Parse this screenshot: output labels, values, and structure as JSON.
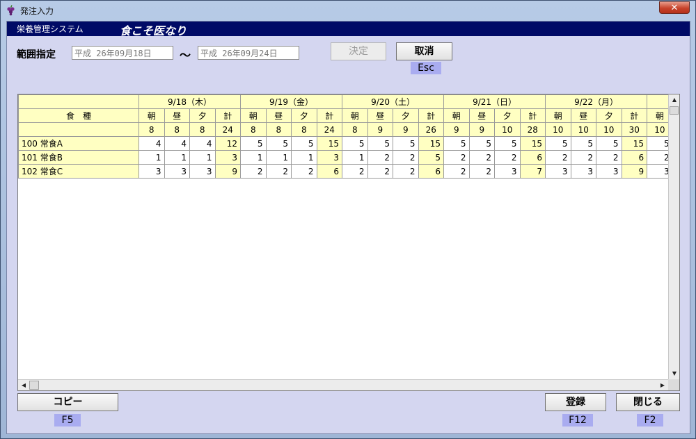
{
  "window": {
    "title": "発注入力",
    "close_label": "✕"
  },
  "header": {
    "system_name": "栄養管理システム",
    "logo_text": "食こそ医なり"
  },
  "range": {
    "label": "範囲指定",
    "from": "平成 26年09月18日",
    "separator": "〜",
    "to": "平成 26年09月24日"
  },
  "buttons": {
    "decide": "決定",
    "cancel": "取消",
    "cancel_key": "Esc",
    "copy": "コピー",
    "copy_key": "F5",
    "register": "登録",
    "register_key": "F12",
    "close": "閉じる",
    "close_key": "F2"
  },
  "grid": {
    "row_header": "食　種",
    "meal_labels": [
      "朝",
      "昼",
      "夕",
      "計"
    ],
    "days": [
      {
        "label": "9/18（木）",
        "totals": [
          "8",
          "8",
          "8",
          "24"
        ],
        "rows": [
          [
            "4",
            "4",
            "4",
            "12"
          ],
          [
            "1",
            "1",
            "1",
            "3"
          ],
          [
            "3",
            "3",
            "3",
            "9"
          ]
        ]
      },
      {
        "label": "9/19（金）",
        "totals": [
          "8",
          "8",
          "8",
          "24"
        ],
        "rows": [
          [
            "5",
            "5",
            "5",
            "15"
          ],
          [
            "1",
            "1",
            "1",
            "3"
          ],
          [
            "2",
            "2",
            "2",
            "6"
          ]
        ]
      },
      {
        "label": "9/20（土）",
        "totals": [
          "8",
          "9",
          "9",
          "26"
        ],
        "rows": [
          [
            "5",
            "5",
            "5",
            "15"
          ],
          [
            "1",
            "2",
            "2",
            "5"
          ],
          [
            "2",
            "2",
            "2",
            "6"
          ]
        ]
      },
      {
        "label": "9/21（日）",
        "totals": [
          "9",
          "9",
          "10",
          "28"
        ],
        "rows": [
          [
            "5",
            "5",
            "5",
            "15"
          ],
          [
            "2",
            "2",
            "2",
            "6"
          ],
          [
            "2",
            "2",
            "3",
            "7"
          ]
        ]
      },
      {
        "label": "9/22（月）",
        "totals": [
          "10",
          "10",
          "10",
          "30"
        ],
        "rows": [
          [
            "5",
            "5",
            "5",
            "15"
          ],
          [
            "2",
            "2",
            "2",
            "6"
          ],
          [
            "3",
            "3",
            "3",
            "9"
          ]
        ]
      }
    ],
    "partial_day": {
      "meal": "朝",
      "total": "10",
      "rows": [
        "5",
        "2",
        "3"
      ]
    },
    "foods": [
      "100 常食A",
      "101 常食B",
      "102 常食C"
    ]
  },
  "colors": {
    "header_bg": "#000a66",
    "highlight": "#ffffc2",
    "client_bg": "#d4d6f0",
    "key_bg": "#a9acf0"
  }
}
